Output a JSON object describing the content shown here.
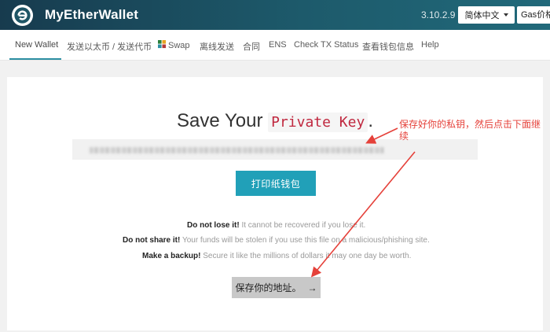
{
  "header": {
    "brand": "MyEtherWallet",
    "version": "3.10.2.9",
    "language_button": "简体中文",
    "gas_button": "Gas价格"
  },
  "nav": {
    "items": [
      {
        "label": "New Wallet",
        "active": true
      },
      {
        "label": "发送以太币 / 发送代币"
      },
      {
        "label": "Swap",
        "icon": "swap-icon"
      },
      {
        "label": "离线发送"
      },
      {
        "label": "合同"
      },
      {
        "label": "ENS"
      },
      {
        "label": "Check TX Status"
      },
      {
        "label": "查看钱包信息"
      },
      {
        "label": "Help"
      }
    ]
  },
  "main": {
    "title_prefix": "Save Your",
    "title_code": "Private Key",
    "title_suffix": ".",
    "print_button": "打印纸钱包",
    "warnings": [
      {
        "bold": "Do not lose it!",
        "text": " It cannot be recovered if you lose it."
      },
      {
        "bold": "Do not share it!",
        "text": " Your funds will be stolen if you use this file on a malicious/phishing site."
      },
      {
        "bold": "Make a backup!",
        "text": " Secure it like the millions of dollars it may one day be worth."
      }
    ],
    "save_button": "保存你的地址。",
    "save_arrow": "→"
  },
  "annotation": {
    "text": "保存好你的私钥，然后点击下面继续",
    "color": "#e5413a"
  },
  "colors": {
    "header_start": "#173b4e",
    "header_end": "#21697a",
    "accent": "#21a0b8",
    "code_red": "#c0283f"
  }
}
